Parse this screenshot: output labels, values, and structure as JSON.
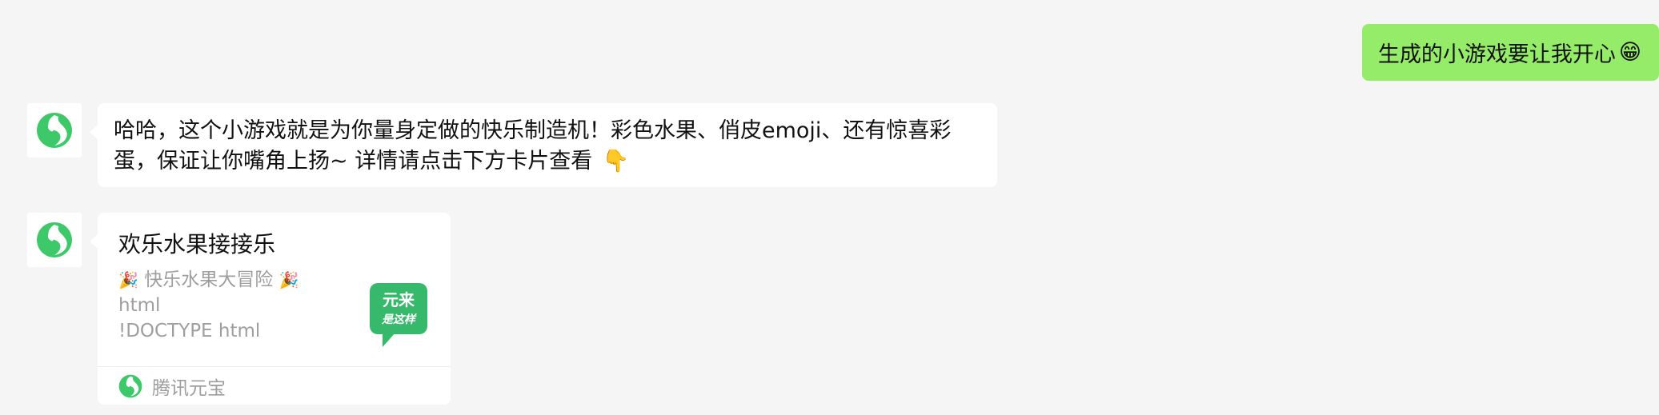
{
  "user_message": {
    "text": "生成的小游戏要让我开心",
    "emoji": "😁"
  },
  "bot_message": {
    "line1": "哈哈，这个小游戏就是为你量身定做的快乐制造机！彩色水果、俏皮emoji、还有惊喜彩",
    "line2": "蛋，保证让你嘴角上扬~ 详情请点击下方卡片查看",
    "emoji": "👇"
  },
  "card": {
    "title": "欢乐水果接接乐",
    "subtitle_emoji": "🎉",
    "subtitle": "快乐水果大冒险",
    "line2": "html",
    "line3": "!DOCTYPE html",
    "thumb_text_top": "元来",
    "thumb_text_bottom": "是这样",
    "footer_source": "腾讯元宝"
  },
  "colors": {
    "user_bubble": "#95ec69",
    "brand_green": "#3dc86a",
    "thumb_green": "#37b96b",
    "background": "#f5f5f5"
  },
  "icons": {
    "avatar": "yuanbao-logo-icon",
    "footer": "yuanbao-logo-icon",
    "thumbnail": "speech-bubble-logo-icon"
  }
}
